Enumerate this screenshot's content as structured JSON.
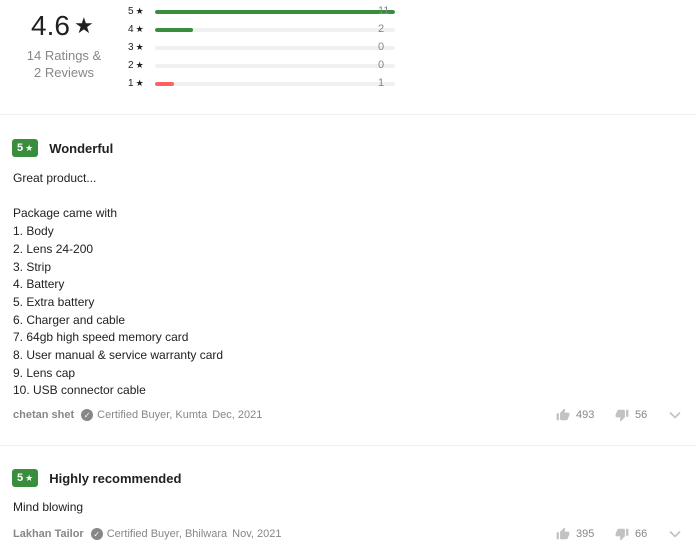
{
  "summary": {
    "average": "4.6",
    "star": "★",
    "ratings_text": "14 Ratings &",
    "reviews_text": "2 Reviews",
    "breakdown": [
      {
        "stars": "5",
        "count": "11",
        "fraction": 1.0
      },
      {
        "stars": "4",
        "count": "2",
        "fraction": 0.16
      },
      {
        "stars": "3",
        "count": "0",
        "fraction": 0
      },
      {
        "stars": "2",
        "count": "0",
        "fraction": 0
      },
      {
        "stars": "1",
        "count": "1",
        "fraction": 0.08
      }
    ],
    "colors": {
      "bar_high": "#388e3c",
      "bar_low": "#ff6161"
    }
  },
  "reviews": [
    {
      "rating": "5",
      "star": "★",
      "title": "Wonderful",
      "body": "Great product...\n\nPackage came with\n1. Body\n2. Lens 24-200\n3. Strip\n4. Battery\n5. Extra battery\n6. Charger and cable\n7. 64gb high speed memory card\n8. User manual & service warranty card\n9. Lens cap\n10. USB connector cable",
      "author": "chetan shet",
      "certified": "Certified Buyer, Kumta",
      "date": "Dec, 2021",
      "likes": "493",
      "dislikes": "56"
    },
    {
      "rating": "5",
      "star": "★",
      "title": "Highly recommended",
      "body": "Mind blowing",
      "author": "Lakhan Tailor",
      "certified": "Certified Buyer, Bhilwara",
      "date": "Nov, 2021",
      "likes": "395",
      "dislikes": "66"
    }
  ],
  "icons": {
    "check": "✓",
    "like": "thumbs-up-icon",
    "dislike": "thumbs-down-icon",
    "expand": "chevron-down-icon"
  },
  "colors": {
    "rating_badge": "#388e3c",
    "muted_text": "#878787"
  }
}
